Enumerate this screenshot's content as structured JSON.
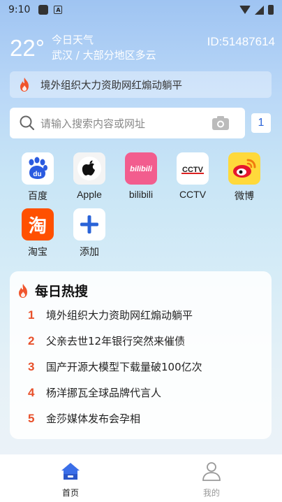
{
  "status_bar": {
    "time": "9:10"
  },
  "weather": {
    "temperature": "22°",
    "title": "今日天气",
    "location_condition": "武汉 / 大部分地区多云",
    "user_id": "ID:51487614"
  },
  "hot_banner": {
    "text": "境外组织大力资助网红煽动躺平"
  },
  "search": {
    "placeholder": "请输入搜索内容或网址",
    "tab_count": "1"
  },
  "shortcuts": [
    {
      "label": "百度",
      "icon": "baidu-icon"
    },
    {
      "label": "Apple",
      "icon": "apple-icon"
    },
    {
      "label": "bilibili",
      "icon": "bilibili-icon"
    },
    {
      "label": "CCTV",
      "icon": "cctv-icon"
    },
    {
      "label": "微博",
      "icon": "weibo-icon"
    },
    {
      "label": "淘宝",
      "icon": "taobao-icon"
    },
    {
      "label": "添加",
      "icon": "plus-icon"
    }
  ],
  "hot_search": {
    "title": "每日热搜",
    "items": [
      {
        "rank": "1",
        "text": "境外组织大力资助网红煽动躺平"
      },
      {
        "rank": "2",
        "text": "父亲去世12年银行突然来催债"
      },
      {
        "rank": "3",
        "text": "国产开源大模型下载量破100亿次"
      },
      {
        "rank": "4",
        "text": "杨洋挪瓦全球品牌代言人"
      },
      {
        "rank": "5",
        "text": "金莎媒体发布会孕相"
      }
    ]
  },
  "bottom_nav": [
    {
      "label": "首页",
      "active": true
    },
    {
      "label": "我的",
      "active": false
    }
  ],
  "colors": {
    "accent": "#2a63d8",
    "rank": "#e8502a",
    "flame": "#f0552d"
  }
}
